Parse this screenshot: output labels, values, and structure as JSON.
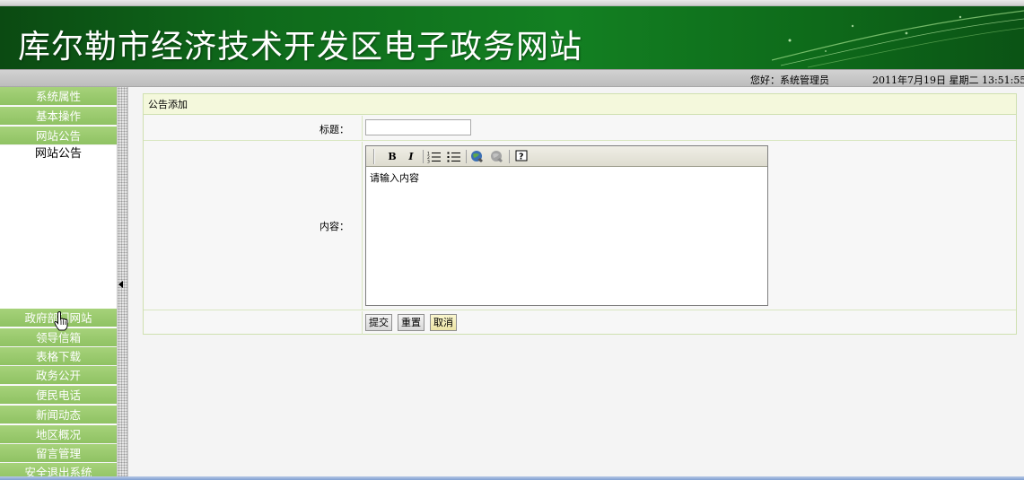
{
  "banner": {
    "title": "库尔勒市经济技术开发区电子政务网站"
  },
  "status": {
    "user": "您好：系统管理员",
    "date": "2011年7月19日  星期二  13:51:55"
  },
  "sidebar": {
    "top_items": [
      {
        "label": "系统属性"
      },
      {
        "label": "基本操作"
      },
      {
        "label": "网站公告"
      }
    ],
    "sub_items": [
      {
        "label": "网站公告"
      }
    ],
    "bottom_items": [
      {
        "label": "政府部门网站"
      },
      {
        "label": "领导信箱"
      },
      {
        "label": "表格下载"
      },
      {
        "label": "政务公开"
      },
      {
        "label": "便民电话"
      },
      {
        "label": "新闻动态"
      },
      {
        "label": "地区概况"
      },
      {
        "label": "留言管理"
      },
      {
        "label": "安全退出系统"
      }
    ]
  },
  "form": {
    "header": "公告添加",
    "title_label": "标题：",
    "title_value": "",
    "content_label": "内容：",
    "content_value": "请输入内容",
    "toolbar": {
      "bold": "B",
      "italic": "I",
      "help": "?"
    },
    "submit_label": "提交",
    "reset_label": "重置",
    "cancel_label": "取消"
  },
  "icons": {
    "ordered_list": "ordered-list-icon",
    "unordered_list": "unordered-list-icon",
    "link": "link-icon",
    "unlink": "unlink-icon",
    "help": "help-icon",
    "collapse": "collapse-arrow-icon",
    "cursor": "hand-cursor-icon"
  },
  "colors": {
    "banner": "#138022",
    "menu_green": "#9bcb6e",
    "panel_header": "#f4f8dc",
    "cancel_button": "#f4eeb8"
  }
}
